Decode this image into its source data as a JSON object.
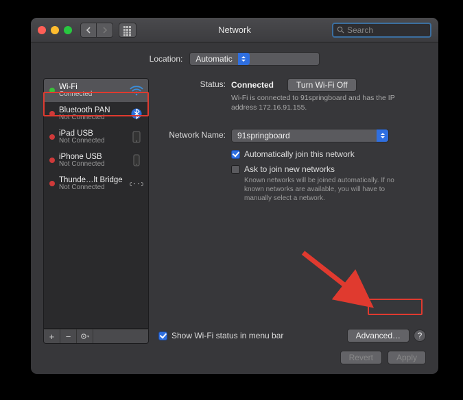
{
  "title": "Network",
  "search_placeholder": "Search",
  "location_label": "Location:",
  "location_value": "Automatic",
  "sidebar": {
    "items": [
      {
        "name": "Wi-Fi",
        "status": "Connected",
        "dot": "green",
        "icon": "wifi"
      },
      {
        "name": "Bluetooth PAN",
        "status": "Not Connected",
        "dot": "red",
        "icon": "bluetooth"
      },
      {
        "name": "iPad USB",
        "status": "Not Connected",
        "dot": "red",
        "icon": "device"
      },
      {
        "name": "iPhone USB",
        "status": "Not Connected",
        "dot": "red",
        "icon": "device"
      },
      {
        "name": "Thunde…lt Bridge",
        "status": "Not Connected",
        "dot": "red",
        "icon": "thunderbolt"
      }
    ]
  },
  "detail": {
    "status_label": "Status:",
    "status_value": "Connected",
    "turn_off_label": "Turn Wi-Fi Off",
    "status_desc": "Wi-Fi is connected to 91springboard and has the IP address 172.16.91.155.",
    "network_name_label": "Network Name:",
    "network_name_value": "91springboard",
    "auto_join_label": "Automatically join this network",
    "auto_join_checked": true,
    "ask_join_label": "Ask to join new networks",
    "ask_join_checked": false,
    "ask_join_desc": "Known networks will be joined automatically. If no known networks are available, you will have to manually select a network.",
    "show_status_label": "Show Wi-Fi status in menu bar",
    "show_status_checked": true,
    "advanced_label": "Advanced…",
    "help_label": "?"
  },
  "footer": {
    "revert": "Revert",
    "apply": "Apply"
  }
}
